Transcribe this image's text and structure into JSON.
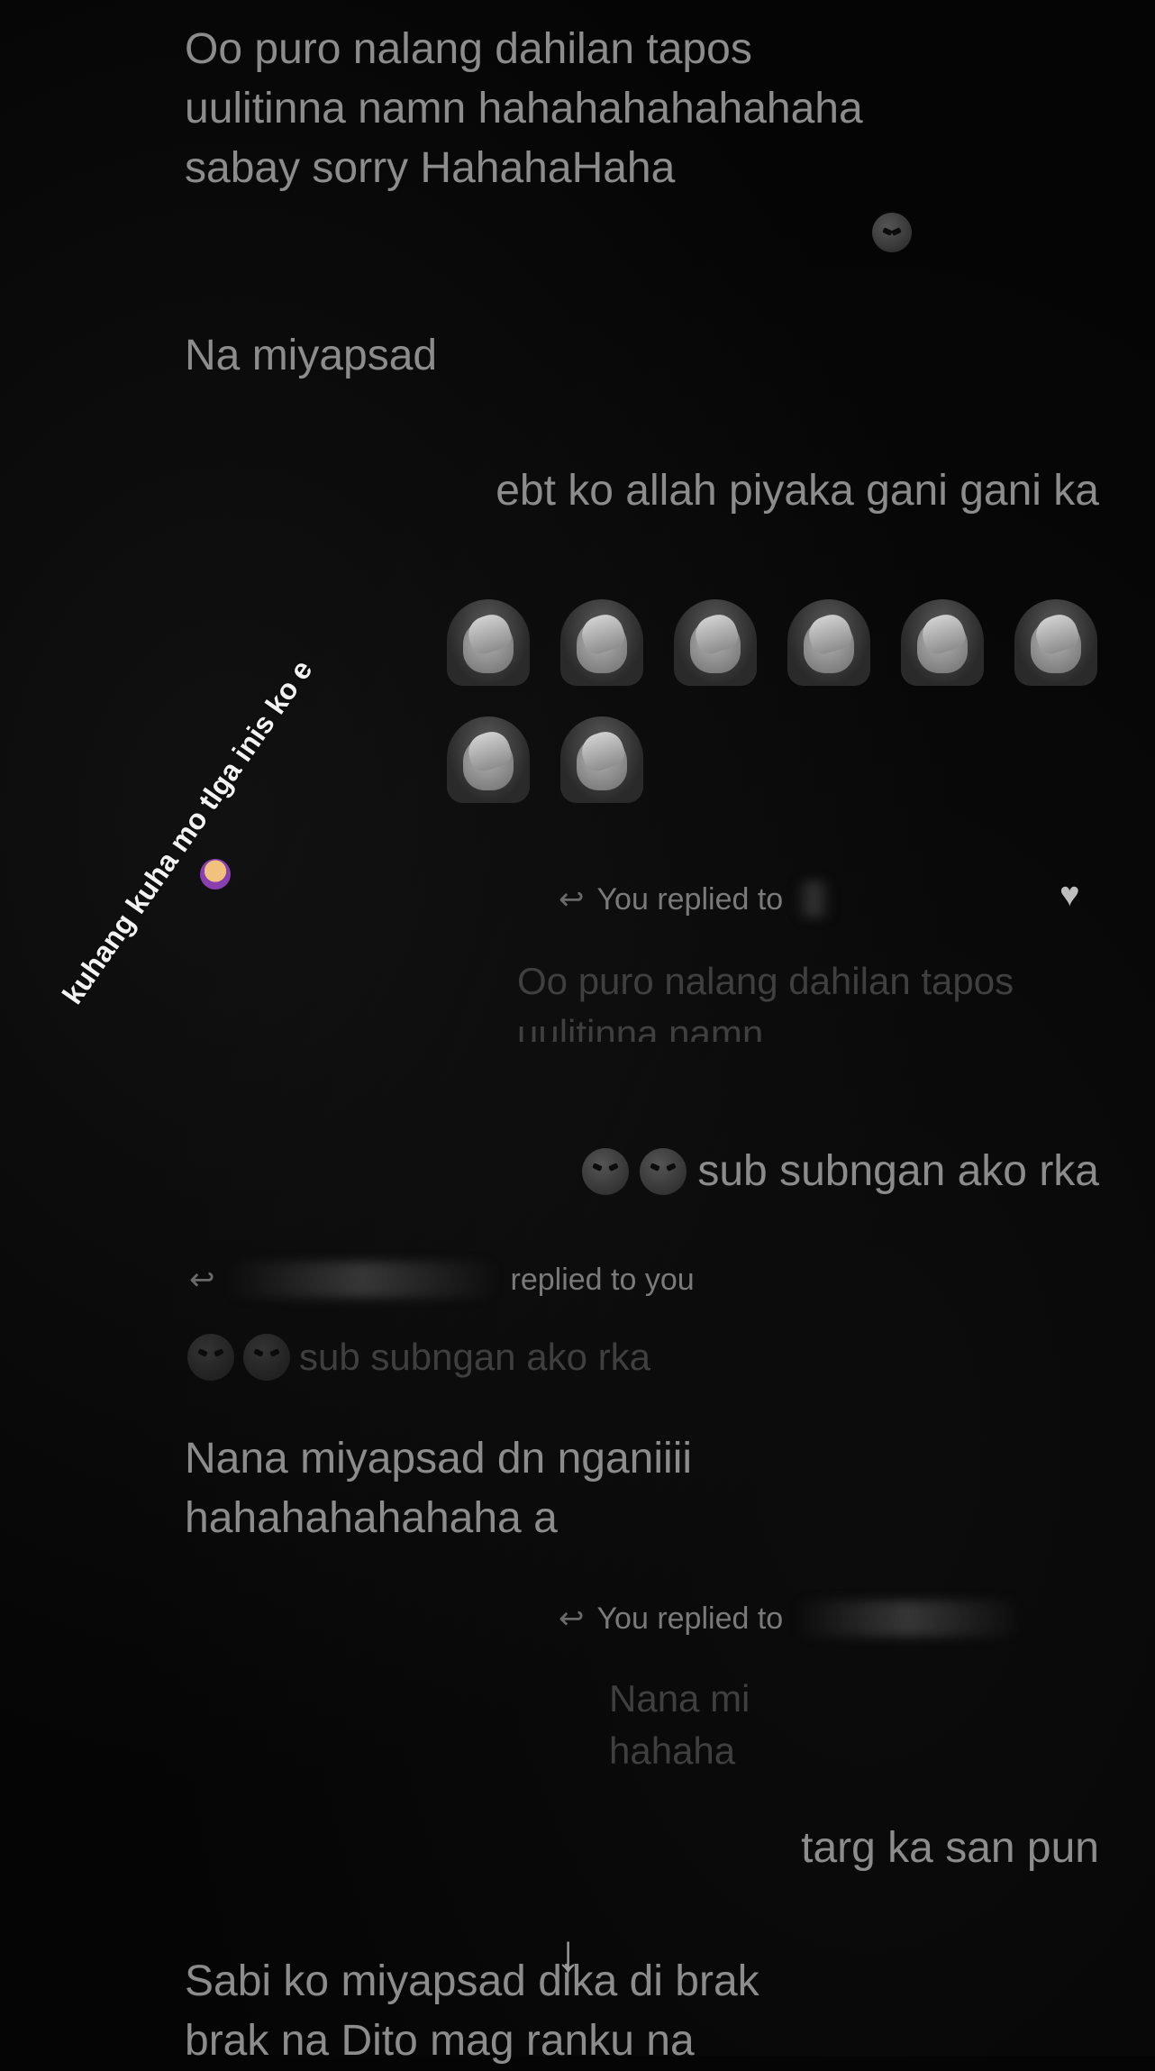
{
  "messages": {
    "m1": "Oo puro nalang dahilan tapos\nuulitinna namn hahahahahahahaha\nsabay sorry HahahaHaha",
    "m2": "Na miyapsad",
    "m3": "ebt ko allah piyaka gani gani ka",
    "m4": "sub subngan ako rka",
    "m5": "Nana miyapsad dn nganiiii\nhahahahahahaha a",
    "m6": "targ ka san pun",
    "m7": "Sabi ko miyapsad  dika di brak\nbrak na Dito mag ranku na"
  },
  "replies": {
    "r1_label": "You replied to",
    "r1_quote": "Oo puro nalang dahilan tapos\nuulitinna namn",
    "r2_label": "replied to you",
    "r2_quote": "sub subngan ako rka",
    "r3_label": "You replied to",
    "r3_quote": "Nana mi\nhahaha"
  },
  "overlay": {
    "caption": "kuhang kuha mo tlga inis ko e"
  },
  "icons": {
    "reply": "reply-arrow-icon",
    "reaction": "heart-icon",
    "scroll": "scroll-down-arrow-icon",
    "emoji_angry": "angry-face-emoji",
    "emoji_facepalm": "facepalm-emoji"
  }
}
